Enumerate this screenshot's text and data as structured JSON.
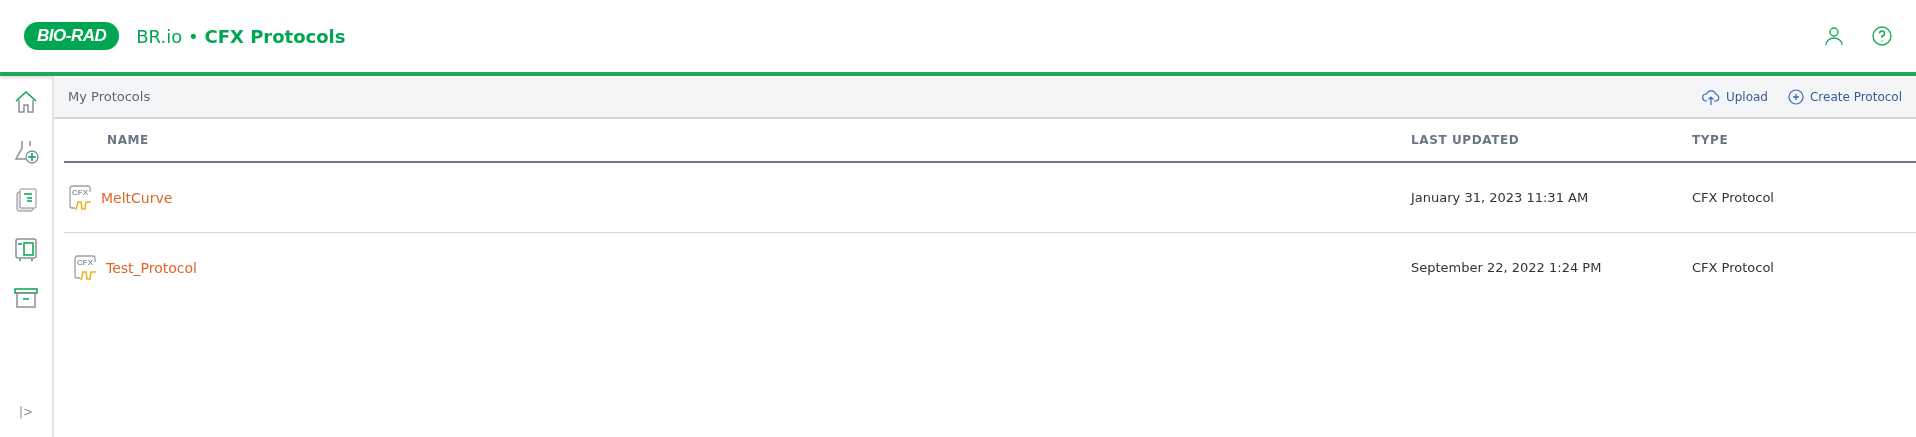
{
  "header": {
    "logo": "BIO-RAD",
    "app": "BR.io",
    "separator": "•",
    "title": "CFX Protocols"
  },
  "sidebar": {
    "items": [
      {
        "kind": "home"
      },
      {
        "kind": "flask"
      },
      {
        "kind": "documents"
      },
      {
        "kind": "instrument"
      },
      {
        "kind": "archive"
      }
    ],
    "expand": "|>"
  },
  "toolbar": {
    "breadcrumb": "My Protocols",
    "actions": [
      {
        "kind": "upload",
        "label": "Upload"
      },
      {
        "kind": "create",
        "label": "Create Protocol"
      }
    ]
  },
  "table": {
    "columns": [
      "NAME",
      "LAST UPDATED",
      "TYPE"
    ],
    "rows": [
      {
        "icon_label": "CFX",
        "name": "MeltCurve",
        "last_updated": "January 31, 2023 11:31 AM",
        "type": "CFX Protocol"
      },
      {
        "icon_label": "CFX",
        "name": "Test_Protocol",
        "last_updated": "September 22, 2022 1:24 PM",
        "type": "CFX Protocol"
      }
    ]
  }
}
